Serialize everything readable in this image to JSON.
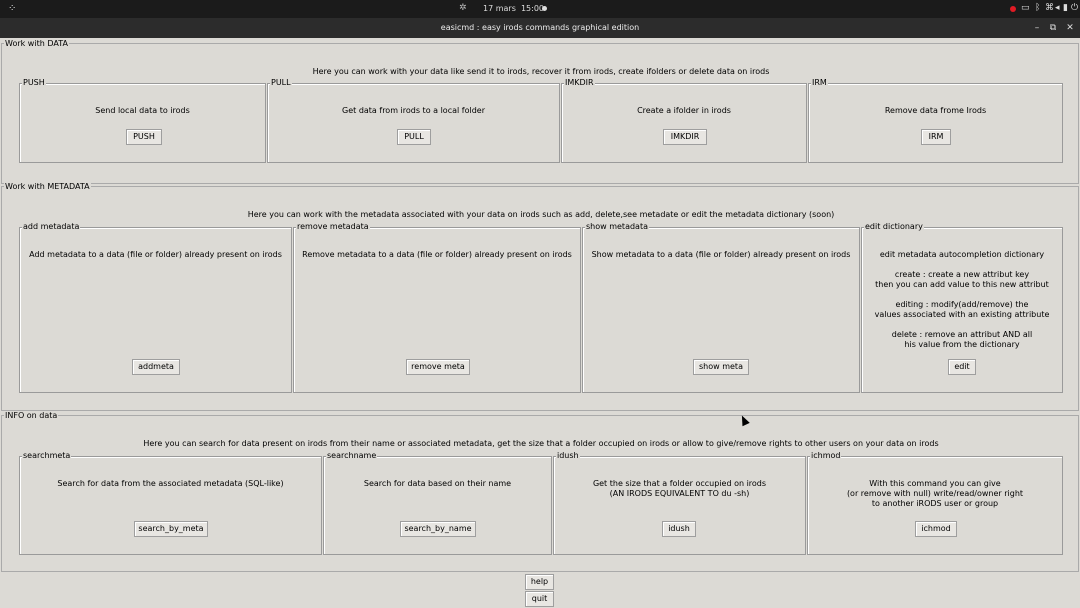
{
  "topbar": {
    "datetime": "17 mars  15:00",
    "activities_icon": "grid-icon",
    "tray_icons": [
      "record-icon",
      "window-icon",
      "bluetooth-icon",
      "network-icon",
      "volume-icon",
      "battery-icon",
      "power-icon"
    ],
    "record_color": "#e01b24"
  },
  "window": {
    "title": "easicmd : easy irods commands graphical edition",
    "controls": [
      "minimize",
      "maximize",
      "close"
    ]
  },
  "sections": {
    "data": {
      "title": "Work with DATA",
      "intro": "Here you can work with your data like send it to irods, recover it from irods, create ifolders or delete data on irods",
      "panels": [
        {
          "label": "PUSH",
          "desc": "Send local data to irods",
          "button": "PUSH"
        },
        {
          "label": "PULL",
          "desc": "Get data from irods to a local folder",
          "button": "PULL"
        },
        {
          "label": "IMKDIR",
          "desc": "Create a ifolder in irods",
          "button": "IMKDIR"
        },
        {
          "label": "IRM",
          "desc": "Remove data frome Irods",
          "button": "IRM"
        }
      ]
    },
    "metadata": {
      "title": "Work with METADATA",
      "intro": "Here you can work with the metadata associated with your data on irods such as add, delete,see metadate or edit the metadata dictionary (soon)",
      "panels": [
        {
          "label": "add metadata",
          "desc": "Add metadata to a data (file or folder) already present on irods",
          "button": "addmeta"
        },
        {
          "label": "remove metadata",
          "desc": "Remove metadata to a data (file or folder) already present on irods",
          "button": "remove meta"
        },
        {
          "label": "show metadata",
          "desc": "Show metadata to a data (file or folder) already present on irods",
          "button": "show meta"
        },
        {
          "label": "edit dictionary",
          "desc": "edit metadata autocompletion dictionary\n\ncreate : create a new attribut key\nthen you can add value to this new attribut\n\nediting : modify(add/remove) the\nvalues associated with an existing attribute\n\ndelete : remove an attribut AND all\nhis value from the dictionary",
          "button": "edit"
        }
      ]
    },
    "info": {
      "title": "INFO on data",
      "intro": "Here you can search for data present on irods from their name or associated metadata, get the size that a folder occupied on irods or allow to give/remove rights to other users on your data on irods",
      "panels": [
        {
          "label": "searchmeta",
          "desc": "Search for data from the associated metadata (SQL-like)",
          "button": "search_by_meta"
        },
        {
          "label": "searchname",
          "desc": "Search for data based on their name",
          "button": "search_by_name"
        },
        {
          "label": "idush",
          "desc": "Get the size that a folder occupied on irods\n(AN IRODS EQUIVALENT TO du -sh)",
          "button": "idush"
        },
        {
          "label": "ichmod",
          "desc": "With this command you can give\n(or remove with null) write/read/owner right\nto another iRODS user or group",
          "button": "ichmod"
        }
      ]
    }
  },
  "footer": {
    "help": "help",
    "quit": "quit"
  }
}
